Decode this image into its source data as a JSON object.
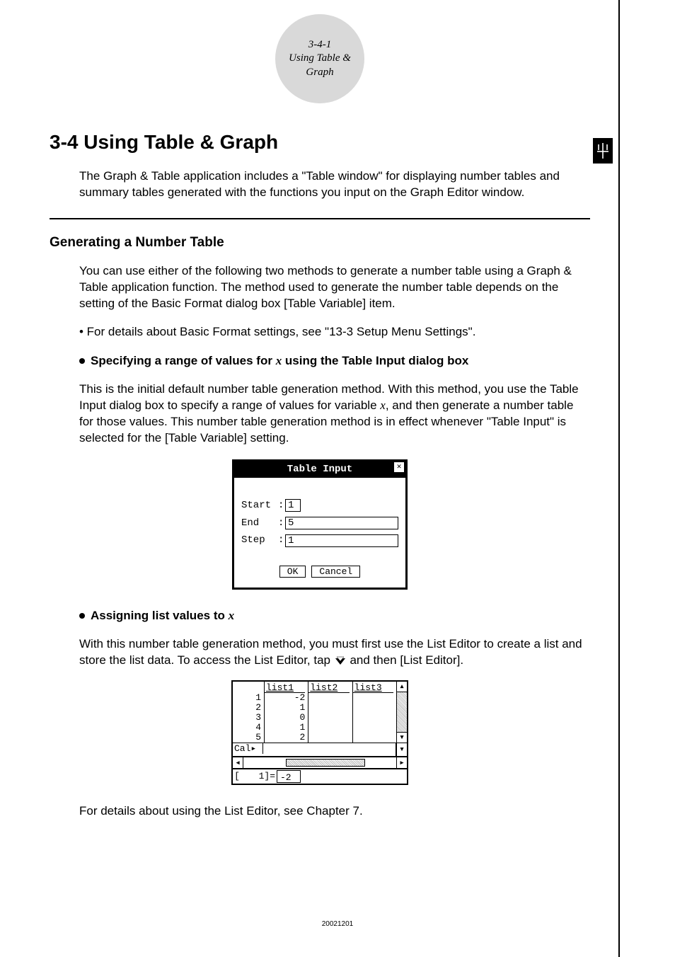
{
  "header": {
    "page_ref": "3-4-1",
    "section_title": "Using Table & Graph"
  },
  "title": "3-4  Using Table & Graph",
  "intro": "The Graph & Table application includes a \"Table window\" for displaying number tables and summary tables generated with the functions you input on the Graph Editor window.",
  "subhead": "Generating a Number Table",
  "para1": "You can use either of the following two methods to generate a number table using a Graph & Table application function. The method used to generate the number table depends on the setting of the Basic Format dialog box [Table Variable] item.",
  "bullet1": "• For details about Basic Format settings, see \"13-3 Setup Menu Settings\".",
  "sub_bullet_a_pre": "Specifying a range of values for ",
  "sub_bullet_a_var": "x",
  "sub_bullet_a_post": " using the Table Input dialog box",
  "para_a_pre": "This is the initial default number table generation method. With this method, you use the Table Input dialog box to specify a range of values for variable ",
  "para_a_var": "x",
  "para_a_post": ", and then generate a number table for those values. This number table generation method is in effect whenever \"Table Input\" is selected for the [Table Variable] setting.",
  "dialog": {
    "title": "Table Input",
    "rows": [
      {
        "label": "Start",
        "value": "1"
      },
      {
        "label": "End",
        "value": "5"
      },
      {
        "label": "Step",
        "value": "1"
      }
    ],
    "ok": "OK",
    "cancel": "Cancel"
  },
  "sub_bullet_b_pre": "Assigning list values to ",
  "sub_bullet_b_var": "x",
  "para_b_pre": "With this number table generation method, you must first use the List Editor to create a list and store the list data. To access the List Editor, tap ",
  "para_b_post": " and then [List Editor].",
  "list_panel": {
    "headers": [
      "list1",
      "list2",
      "list3"
    ],
    "row_numbers": [
      "1",
      "2",
      "3",
      "4",
      "5"
    ],
    "col1": [
      "-2",
      "1",
      "0",
      "1",
      "2"
    ],
    "cal_label": "Cal▸",
    "input_idx": "1]=",
    "input_val": "-2"
  },
  "closing": "For details about using the List Editor, see Chapter 7.",
  "footer": "20021201"
}
